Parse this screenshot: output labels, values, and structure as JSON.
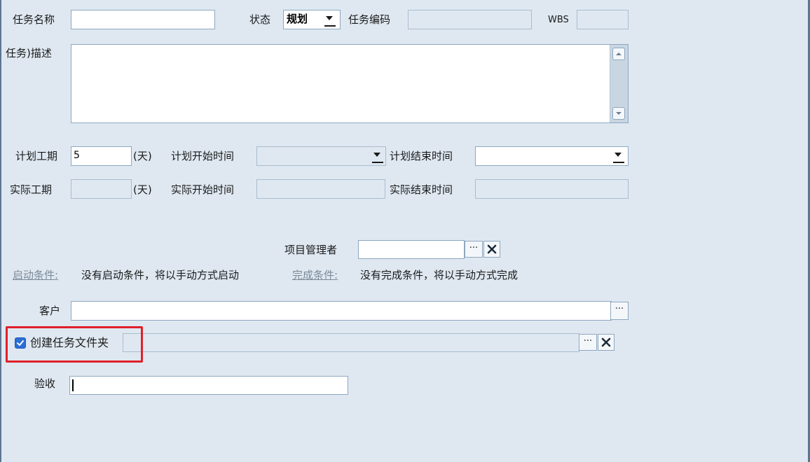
{
  "form": {
    "task_name_label": "任务名称",
    "task_name_value": "",
    "status_label": "状态",
    "status_value": "规划",
    "task_code_label": "任务编码",
    "task_code_value": "",
    "wbs_label": "WBS",
    "wbs_value": "",
    "description_label": "任务)描述",
    "description_value": "",
    "planned_duration_label": "计划工期",
    "planned_duration_value": "5",
    "day_unit": "(天)",
    "planned_start_label": "计划开始时间",
    "planned_end_label": "计划结束时间",
    "actual_duration_label": "实际工期",
    "actual_start_label": "实际开始时间",
    "actual_end_label": "实际结束时间",
    "project_manager_label": "项目管理者",
    "browse_label": "···",
    "start_condition_link": "启动条件:",
    "start_condition_text": "没有启动条件，将以手动方式启动",
    "finish_condition_link": "完成条件:",
    "finish_condition_text": "没有完成条件，将以手动方式完成",
    "customer_label": "客户",
    "create_folder_label": "创建任务文件夹",
    "create_folder_checked": true,
    "acceptance_label": "验收"
  },
  "colors": {
    "background": "#dfe8f1",
    "field_border": "#8ea7c0",
    "checkbox": "#2b6fd6",
    "highlight": "#e0202a",
    "link": "#7c8a98"
  }
}
